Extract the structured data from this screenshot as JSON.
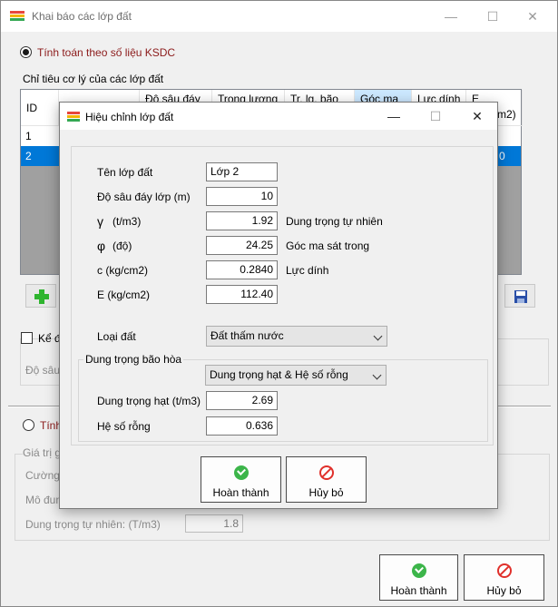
{
  "main": {
    "title": "Khai báo các lớp đất",
    "title_icon_colors": [
      "#e8453c",
      "#f4b400",
      "#34a853"
    ],
    "radio_ksdc_label": "Tính toán theo số liệu KSDC",
    "grid_group_label": "Chỉ tiêu cơ lý của các lớp đất",
    "grid": {
      "headers": [
        "ID",
        "",
        "Độ sâu đáy",
        "Trọng lượng",
        "Tr. lg. bão",
        "Góc ma",
        "Lực dính",
        "E"
      ],
      "header_tail": "m2)",
      "rows": [
        {
          "id": "1",
          "tail": ""
        },
        {
          "id": "2",
          "tail": "0"
        }
      ]
    },
    "checkbox_label": "Kể đ",
    "depth_label": "Độ sâu",
    "radio_second_label": "Tính",
    "second_group_label": "Giá trị g",
    "cuong_label": "Cường",
    "modun_label": "Mô đun",
    "dung_trong_label": "Dung trọng tự nhiên: (T/m3)",
    "dung_trong_value": "1.8",
    "ok_button": "Hoàn thành",
    "cancel_button": "Hủy bỏ"
  },
  "dialog": {
    "title": "Hiệu chỉnh lớp đất",
    "fields": {
      "ten_lop_label": "Tên lớp đất",
      "ten_lop_value": "Lớp 2",
      "do_sau_label": "Độ sâu đáy lớp (m)",
      "do_sau_value": "10",
      "gamma_symbol": "γ",
      "gamma_unit": "(t/m3)",
      "gamma_value": "1.92",
      "gamma_desc": "Dung trọng tự nhiên",
      "phi_symbol": "φ",
      "phi_unit": "(độ)",
      "phi_value": "24.25",
      "phi_desc": "Góc ma sát trong",
      "c_label": "c (kg/cm2)",
      "c_value": "0.2840",
      "c_desc": "Lực dính",
      "e_label": "E (kg/cm2)",
      "e_value": "112.40",
      "loai_dat_label": "Loại đất",
      "loai_dat_value": "Đất thấm nước",
      "bao_hoa_group": "Dung trọng bão hòa",
      "bao_hoa_method": "Dung trọng hạt & Hệ số rỗng",
      "dung_trong_hat_label": "Dung trọng hạt (t/m3)",
      "dung_trong_hat_value": "2.69",
      "he_so_rong_label": "Hệ số rỗng",
      "he_so_rong_value": "0.636"
    },
    "ok_button": "Hoàn thành",
    "cancel_button": "Hủy bỏ"
  },
  "colors": {
    "selection": "#0078d7",
    "header_selected": "#cce8ff",
    "label_red": "#8b1a1a",
    "ok_green": "#3cb54a",
    "cancel_red": "#e0302b",
    "add_green": "#2fb52f",
    "save_blue": "#2a4fa8"
  }
}
